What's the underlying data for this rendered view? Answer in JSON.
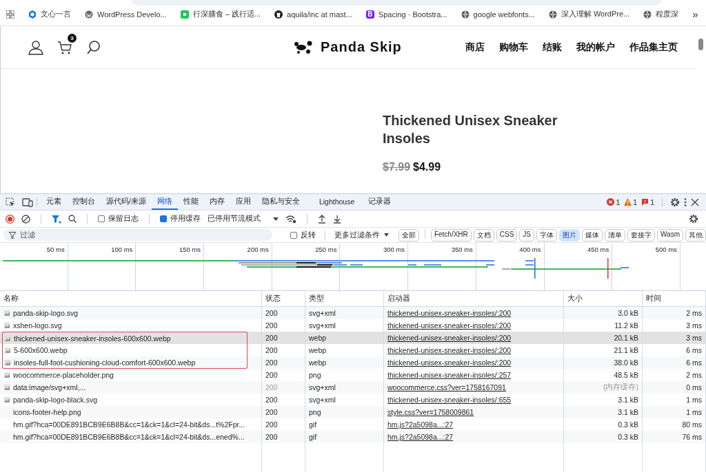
{
  "bookmarks": [
    {
      "kind": "hexagon",
      "label": "文心一言"
    },
    {
      "kind": "wordpress",
      "label": "WordPress Develo..."
    },
    {
      "kind": "square",
      "label": "行深膳食 – 践行适..."
    },
    {
      "kind": "github",
      "label": "aquila/inc at mast..."
    },
    {
      "kind": "letter",
      "letter": "B",
      "label": "Spacing · Bootstra..."
    },
    {
      "kind": "globe",
      "label": "google webfonts..."
    },
    {
      "kind": "globe",
      "label": "深入理解 WordPre..."
    },
    {
      "kind": "globe",
      "label": "程度深"
    }
  ],
  "bookmarks_more": "»",
  "site": {
    "cart_count": "3",
    "logo": "Panda Skip",
    "nav": [
      "商店",
      "购物车",
      "结账",
      "我的帐户",
      "作品集主页"
    ]
  },
  "product": {
    "title": "Thickened Unisex Sneaker Insoles",
    "old_price": "$7.99",
    "price": "$4.99"
  },
  "devtools": {
    "tabs": [
      {
        "label": "元素",
        "selected": false
      },
      {
        "label": "控制台",
        "selected": false
      },
      {
        "label": "源代码/来源",
        "selected": false
      },
      {
        "label": "网络",
        "selected": true
      },
      {
        "label": "性能",
        "selected": false
      },
      {
        "label": "内存",
        "selected": false
      },
      {
        "label": "应用",
        "selected": false
      },
      {
        "label": "隐私与安全",
        "selected": false
      },
      {
        "label": "Lighthouse",
        "selected": false
      },
      {
        "label": "记录器",
        "selected": false
      }
    ],
    "errors": "1",
    "warnings": "1",
    "issues": "1",
    "preserve_log": {
      "label": "保留日志",
      "checked": false
    },
    "disable_cache": {
      "label": "停用缓存",
      "checked": true
    },
    "throttling": "已停用节流模式",
    "filter": {
      "placeholder": "过滤",
      "invert": {
        "label": "反转",
        "checked": false
      },
      "more_filters": "更多过滤条件",
      "types": [
        {
          "label": "全部",
          "selected": false
        },
        {
          "label": "Fetch/XHR",
          "selected": false
        },
        {
          "label": "文档",
          "selected": false
        },
        {
          "label": "CSS",
          "selected": false
        },
        {
          "label": "JS",
          "selected": false
        },
        {
          "label": "字体",
          "selected": false
        },
        {
          "label": "图片",
          "selected": true
        },
        {
          "label": "媒体",
          "selected": false
        },
        {
          "label": "清单",
          "selected": false
        },
        {
          "label": "套接字",
          "selected": false
        },
        {
          "label": "Wasm",
          "selected": false
        },
        {
          "label": "其他",
          "selected": false
        }
      ]
    },
    "timeline_ticks": [
      "50 ms",
      "100 ms",
      "150 ms",
      "200 ms",
      "250 ms",
      "300 ms",
      "350 ms",
      "400 ms",
      "450 ms",
      "500 ms"
    ],
    "columns": [
      "名称",
      "状态",
      "类型",
      "启动器",
      "大小",
      "时间"
    ],
    "rows": [
      {
        "name": "panda-skip-logo.svg",
        "status": "200",
        "type": "svg+xml",
        "initiator": "thickened-unisex-sneaker-insoles/:200",
        "size": "3.0 kB",
        "time": "2 ms",
        "thumbnail": true,
        "selected": false,
        "highlighted": false,
        "cached": false
      },
      {
        "name": "xshen-logo.svg",
        "status": "200",
        "type": "svg+xml",
        "initiator": "thickened-unisex-sneaker-insoles/:200",
        "size": "11.2 kB",
        "time": "3 ms",
        "thumbnail": true,
        "selected": false,
        "highlighted": false,
        "cached": false
      },
      {
        "name": "thickened-unisex-sneaker-insoles-600x600.webp",
        "status": "200",
        "type": "webp",
        "initiator": "thickened-unisex-sneaker-insoles/:200",
        "size": "20.1 kB",
        "time": "3 ms",
        "thumbnail": true,
        "selected": true,
        "highlighted": true,
        "cached": false
      },
      {
        "name": "5-600x600.webp",
        "status": "200",
        "type": "webp",
        "initiator": "thickened-unisex-sneaker-insoles/:200",
        "size": "21.1 kB",
        "time": "6 ms",
        "thumbnail": true,
        "selected": false,
        "highlighted": true,
        "cached": false
      },
      {
        "name": "insoles-full-foot-cushioning-cloud-comfort-600x600.webp",
        "status": "200",
        "type": "webp",
        "initiator": "thickened-unisex-sneaker-insoles/:200",
        "size": "38.0 kB",
        "time": "6 ms",
        "thumbnail": true,
        "selected": false,
        "highlighted": true,
        "cached": false
      },
      {
        "name": "woocommerce-placeholder.png",
        "status": "200",
        "type": "png",
        "initiator": "thickened-unisex-sneaker-insoles/:257",
        "size": "48.5 kB",
        "time": "2 ms",
        "thumbnail": true,
        "selected": false,
        "highlighted": false,
        "cached": false
      },
      {
        "name": "data:image/svg+xml,...",
        "status": "200",
        "type": "svg+xml",
        "initiator": "woocommerce.css?ver=1758167091",
        "size": "(内存缓存)",
        "time": "0 ms",
        "thumbnail": true,
        "selected": false,
        "highlighted": false,
        "cached": true
      },
      {
        "name": "panda-skip-logo-black.svg",
        "status": "200",
        "type": "svg+xml",
        "initiator": "thickened-unisex-sneaker-insoles/:655",
        "size": "3.1 kB",
        "time": "1 ms",
        "thumbnail": true,
        "selected": false,
        "highlighted": false,
        "cached": false
      },
      {
        "name": "icons-footer-help.png",
        "status": "200",
        "type": "png",
        "initiator": "style.css?ver=1758009861",
        "size": "3.1 kB",
        "time": "1 ms",
        "thumbnail": false,
        "selected": false,
        "highlighted": false,
        "cached": false
      },
      {
        "name": "hm.gif?hca=00DE891BCB9E6B8B&cc=1&ck=1&cl=24-bit&ds...t%2Fpr...",
        "status": "200",
        "type": "gif",
        "initiator": "hm.js?2a5098a...:27",
        "size": "0.3 kB",
        "time": "80 ms",
        "thumbnail": false,
        "selected": false,
        "highlighted": false,
        "cached": false
      },
      {
        "name": "hm.gif?hca=00DE891BCB9E6B8B&cc=1&ck=1&cl=24-bit&ds...ened%...",
        "status": "200",
        "type": "gif",
        "initiator": "hm.js?2a5098a...:27",
        "size": "0.3 kB",
        "time": "76 ms",
        "thumbnail": false,
        "selected": false,
        "highlighted": false,
        "cached": false
      }
    ]
  }
}
